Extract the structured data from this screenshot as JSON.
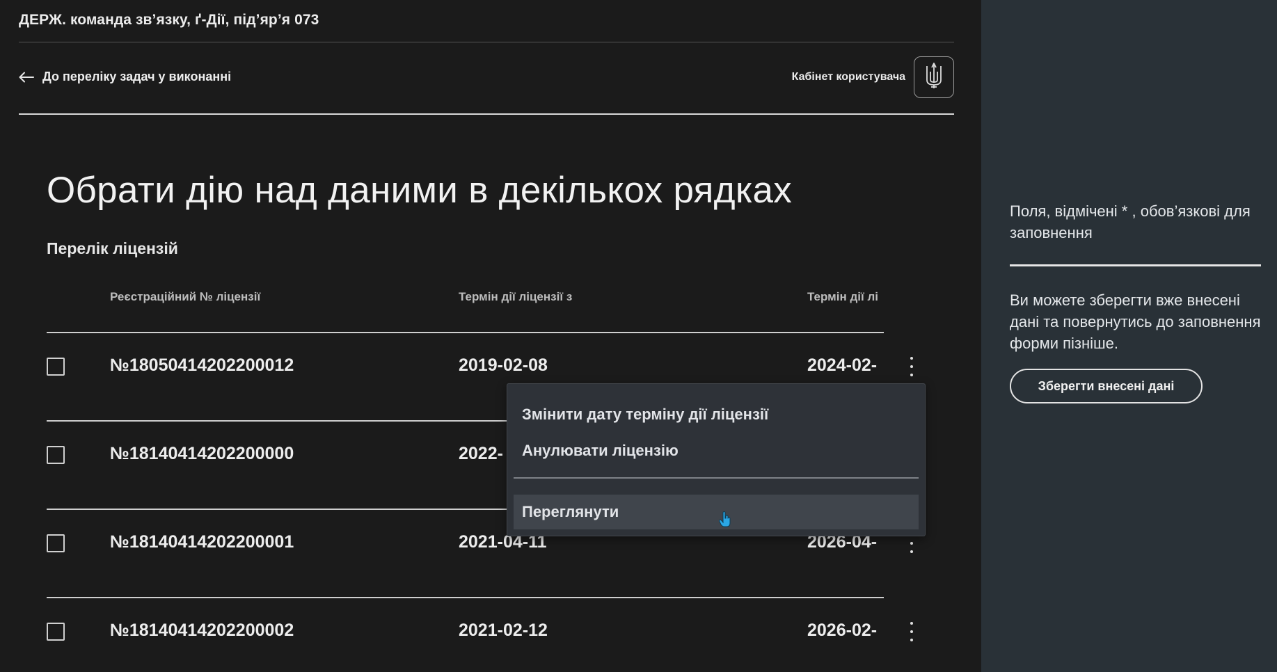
{
  "header": {
    "org_title": "ДЕРЖ. команда зв’язку, ґ-Дії, під’яр’я 073",
    "back_link": "До переліку задач у виконанні",
    "cabinet_label": "Кабінет користувача",
    "avatar_icon": "trident-icon"
  },
  "main": {
    "title": "Обрати дію над даними в декількох рядках",
    "section_title": "Перелік ліцензій",
    "table": {
      "columns": [
        "Реєстраційний № ліцензії",
        "Термін дії ліцензії з",
        "Термін дії лі"
      ],
      "rows": [
        {
          "number": "№18050414202200012",
          "date_from": "2019-02-08",
          "date_to": "2024-02-"
        },
        {
          "number": "№18140414202200000",
          "date_from": "2022-",
          "date_to": ""
        },
        {
          "number": "№18140414202200001",
          "date_from": "2021-04-11",
          "date_to": "2026-04-"
        },
        {
          "number": "№18140414202200002",
          "date_from": "2021-02-12",
          "date_to": "2026-02-"
        }
      ]
    },
    "context_menu": {
      "items": [
        "Змінити дату терміну дії ліцензії",
        "Анулювати ліцензію",
        "Переглянути"
      ]
    }
  },
  "side_panel": {
    "required_note": "Поля, відмічені * , обов’язкові для заповнення",
    "save_note": "Ви можете зберегти вже внесені дані та повернутись до заповнення форми пізніше.",
    "save_button": "Зберегти внесені дані"
  },
  "colors": {
    "background": "#1b1b1b",
    "side_panel": "#293137",
    "menu_bg": "#2e3238",
    "menu_hover": "#40454c"
  }
}
